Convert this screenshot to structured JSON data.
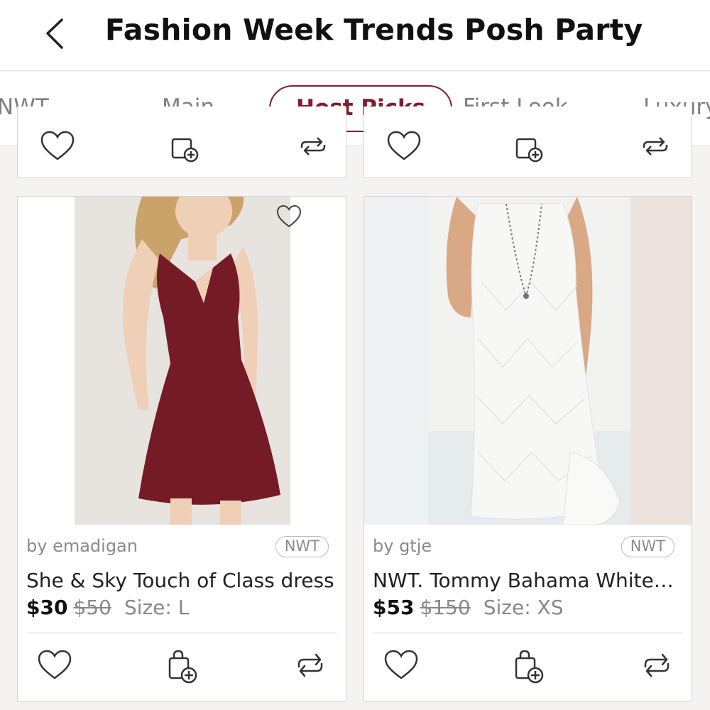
{
  "header": {
    "title": "Fashion Week Trends Posh Party",
    "back_icon": "chevron-left-icon"
  },
  "tabs": [
    {
      "label": "NWT",
      "active": false
    },
    {
      "label": "Main",
      "active": false
    },
    {
      "label": "Host Picks",
      "active": true
    },
    {
      "label": "First Look",
      "active": false
    },
    {
      "label": "Luxury",
      "active": false
    }
  ],
  "colors": {
    "accent": "#7f1f2c",
    "background": "#f4f3f1"
  },
  "listings": [
    {
      "seller": "by emadigan",
      "badge": "NWT",
      "title": "She & Sky Touch of Class dress",
      "price": "$30",
      "original_price": "$50",
      "size": "Size: L",
      "image": "burgundy-sleeveless-dress-photo"
    },
    {
      "seller": "by gtje",
      "badge": "NWT",
      "title": "NWT. Tommy Bahama White…",
      "price": "$53",
      "original_price": "$150",
      "size": "Size: XS",
      "image": "white-eyelet-shift-dress-photo"
    }
  ],
  "action_icons": [
    "heart-icon",
    "add-to-bundle-icon",
    "share-icon"
  ]
}
